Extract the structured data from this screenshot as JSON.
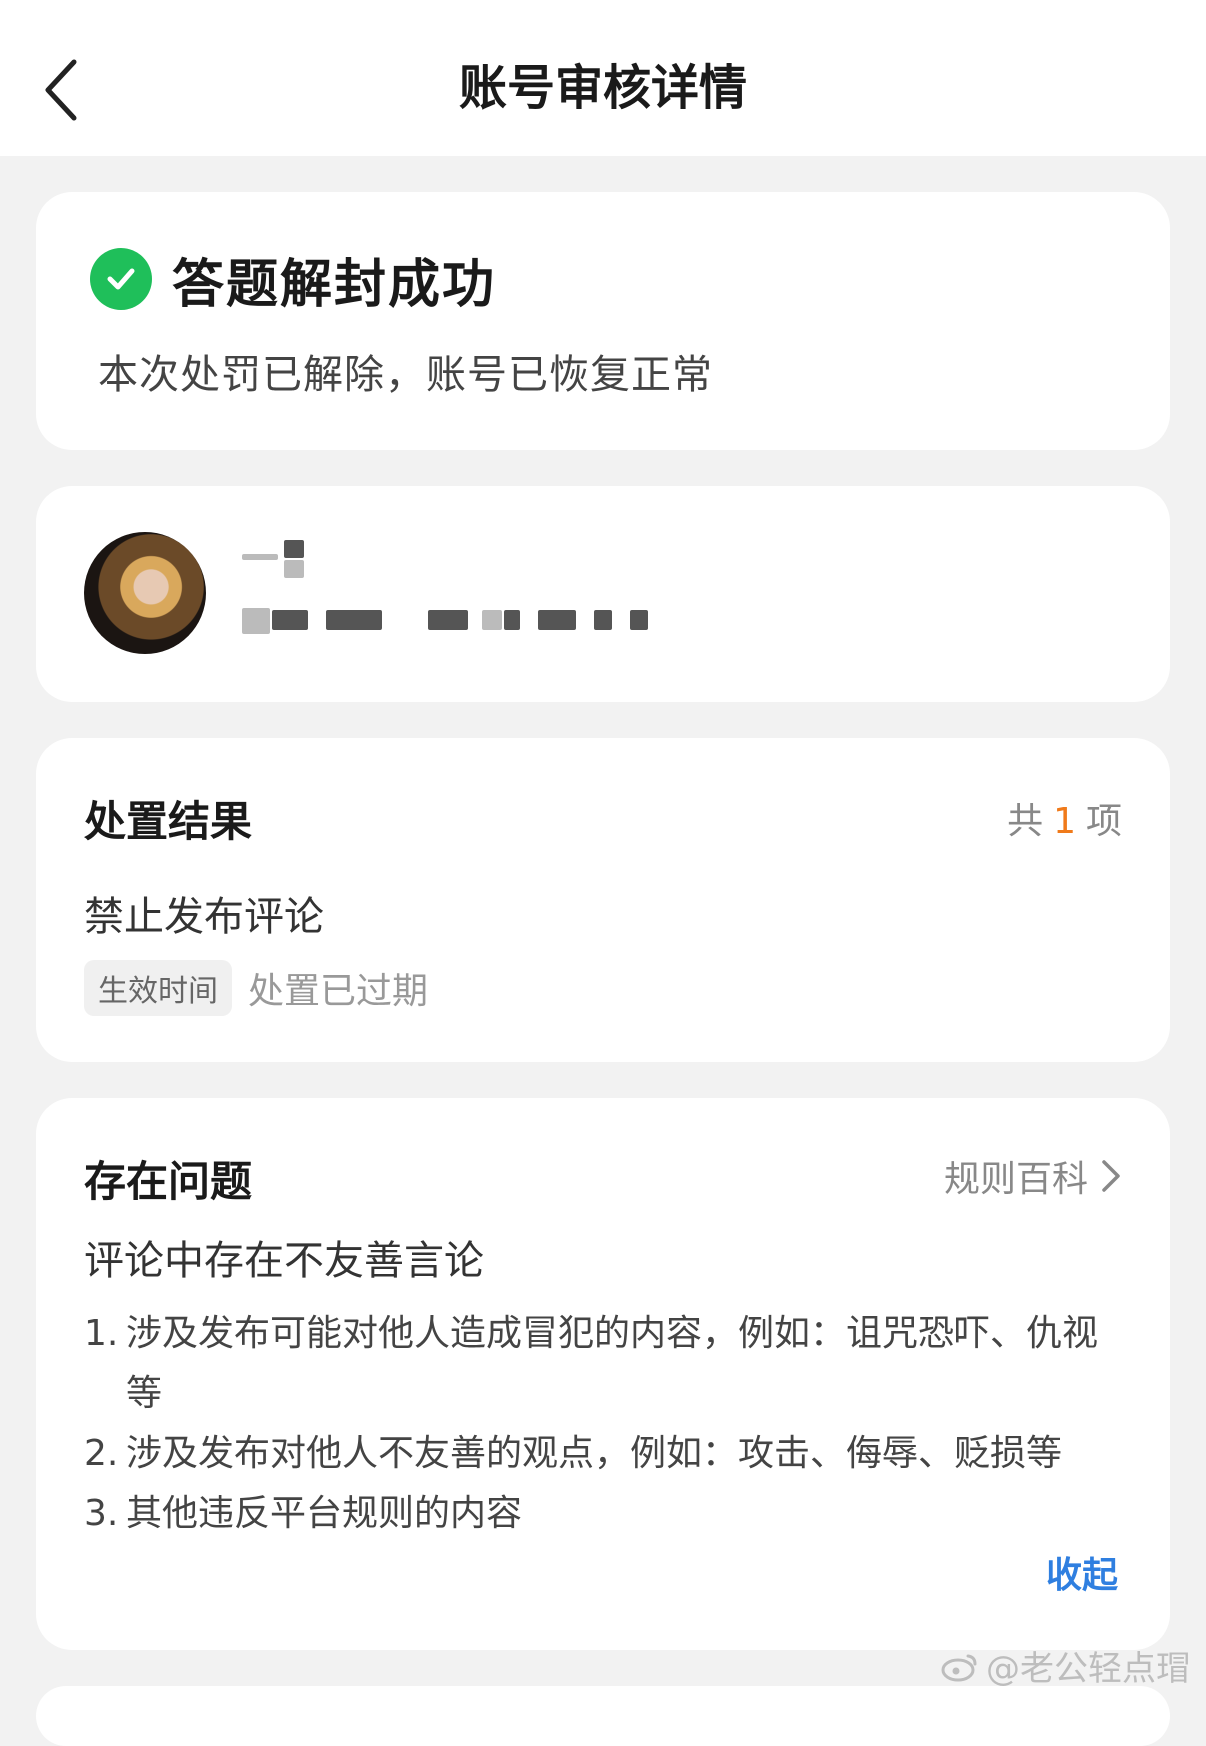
{
  "header": {
    "title": "账号审核详情",
    "back_icon": "chevron-left-icon"
  },
  "status": {
    "icon": "check-circle-icon",
    "icon_color": "#1fbf5a",
    "title": "答题解封成功",
    "description": "本次处罚已解除，账号已恢复正常"
  },
  "profile": {
    "avatar": "avatar-image",
    "name": "",
    "id": ""
  },
  "result": {
    "title": "处置结果",
    "count_prefix": "共",
    "count": "1",
    "count_suffix": "项",
    "count_color": "#f07a1a",
    "item": "禁止发布评论",
    "effect_tag": "生效时间",
    "effect_value": "处置已过期"
  },
  "issues": {
    "title": "存在问题",
    "rules_link": "规则百科",
    "issue_title": "评论中存在不友善言论",
    "list": [
      {
        "index": "1.",
        "text": "涉及发布可能对他人造成冒犯的内容，例如：诅咒恐吓、仇视等"
      },
      {
        "index": "2.",
        "text": "涉及发布对他人不友善的观点，例如：攻击、侮辱、贬损等"
      },
      {
        "index": "3.",
        "text": "其他违反平台规则的内容"
      }
    ],
    "collapse": "收起",
    "link_color": "#2f7fe0"
  },
  "watermark": "@老公轻点瑁"
}
